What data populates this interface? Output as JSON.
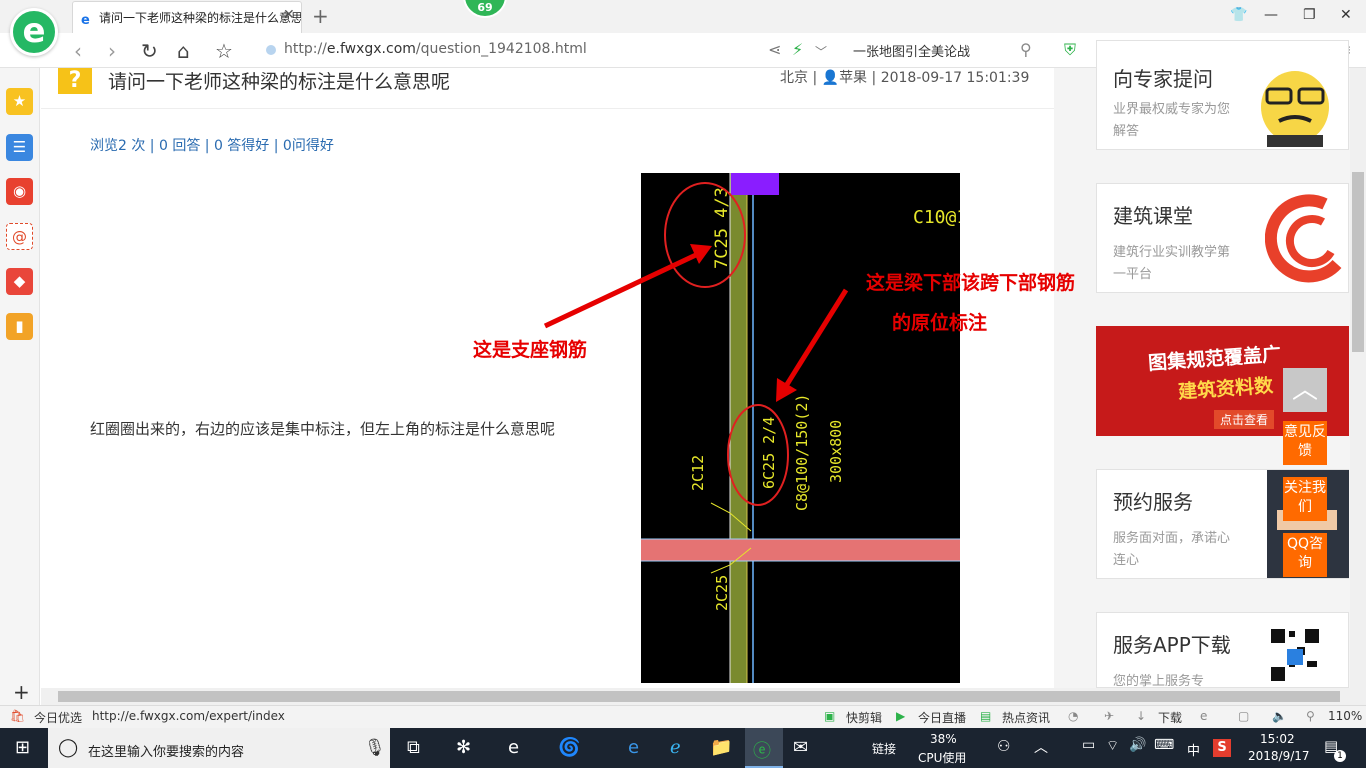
{
  "browser": {
    "tab_title": "请问一下老师这种梁的标注是什么意思呢",
    "new_tab_symbol": "+",
    "badge_count": "69",
    "url_prefix": "http://",
    "url_host": "e.fwxgx.com",
    "url_path": "/question_1942108.html",
    "search_text": "一张地图引全美论战"
  },
  "question": {
    "title": "请问一下老师这种梁的标注是什么意思呢",
    "location": "北京",
    "author": "苹果",
    "datetime": "2018-09-17 15:01:39",
    "stats": "浏览2 次 | 0 回答 | 0 答得好 | 0问得好",
    "body": "红圈圈出来的，右边的应该是集中标注，但左上角的标注是什么意思呢"
  },
  "annotations": {
    "support_rebar": "这是支座钢筋",
    "bottom_rebar_line1": "这是梁下部该跨下部钢筋",
    "bottom_rebar_line2": "的原位标注"
  },
  "cad_labels": {
    "top_right": "C10@1",
    "support": "7C25 4/3",
    "bottom": "6C25 2/4",
    "stirrup": "C8@100/150(2)",
    "section": "300x800",
    "left_upper": "2C12",
    "left_lower": "2C25"
  },
  "sidebar_cards": [
    {
      "title": "向专家提问",
      "sub": "业界最权威专家为您解答"
    },
    {
      "title": "建筑课堂",
      "sub": "建筑行业实训教学第一平台"
    },
    {
      "title": "预约服务",
      "sub": "服务面对面，承诺心连心"
    },
    {
      "title": "服务APP下载",
      "sub": "您的掌上服务专"
    }
  ],
  "banner": {
    "line1": "图集规范覆盖广",
    "line2": "建筑资料数",
    "cta": "点击查看"
  },
  "float_buttons": [
    "意见反馈",
    "关注我们",
    "QQ咨询"
  ],
  "statusbar": {
    "today": "今日优选",
    "link_url": "http://e.fwxgx.com/expert/index",
    "items": [
      "快剪辑",
      "今日直播",
      "热点资讯",
      "下载"
    ],
    "zoom": "110%"
  },
  "taskbar": {
    "search_placeholder": "在这里输入你要搜索的内容",
    "link_label": "链接",
    "cpu_percent": "38%",
    "cpu_label": "CPU使用",
    "ime": "中",
    "time": "15:02",
    "date": "2018/9/17",
    "notification_count": "1"
  }
}
